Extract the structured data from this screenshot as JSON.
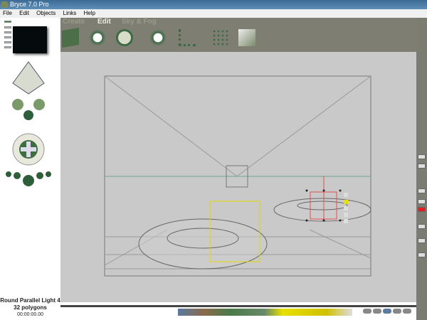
{
  "window": {
    "title": "Bryce 7.0 Pro"
  },
  "menu": [
    "File",
    "Edit",
    "Objects",
    "Links",
    "Help"
  ],
  "toolbar": {
    "tabs": [
      {
        "label": "Create"
      },
      {
        "label": "Edit",
        "active": true
      },
      {
        "label": "Sky & Fog"
      }
    ],
    "tools": [
      "resize-icon",
      "rotate-icon",
      "reposition-icon",
      "align-icon",
      "randomize-icon",
      "material-icon",
      "terrain-edit-icon"
    ]
  },
  "status": {
    "object": "Round Parallel Light 4",
    "polygons": "32 polygons",
    "time": "00:00:00.00"
  },
  "selection_handles": [
    "A",
    "material",
    "link",
    "target",
    "M",
    "E"
  ],
  "colors": {
    "horizon": "#6aa89a",
    "selection": "#e05050",
    "light": "#e8e000",
    "wire": "#555555"
  }
}
